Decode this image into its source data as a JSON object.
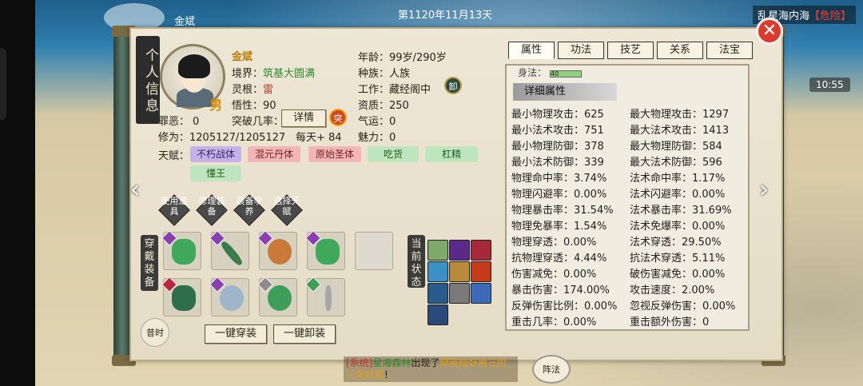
{
  "topbar": {
    "player_name": "金斌",
    "date": "第1120年11月13天",
    "region": "乱星海内海",
    "danger": "【危险】",
    "time": "10:55"
  },
  "panel": {
    "title": "个人信息"
  },
  "char": {
    "name": "金斌",
    "gender": "男",
    "realm_label": "境界：",
    "realm": "筑基大圆满",
    "root_label": "灵根：",
    "root": "雷",
    "comp_label": "悟性：",
    "comp": "90",
    "evil_label": "罪恶：",
    "evil": "0",
    "break_label": "突破几率：",
    "cult_label": "修为：",
    "cult": "1205127/1205127",
    "daily": "每天+ 84",
    "age_label": "年龄：",
    "age": "99岁/290岁",
    "race_label": "种族：",
    "race": "人族",
    "job_label": "工作：",
    "job": "藏经阁中",
    "apt_label": "资质：",
    "apt": "250",
    "qi_label": "气运：",
    "qi": "0",
    "charm_label": "魅力：",
    "charm": "0",
    "talent_label": "天赋：",
    "detail_btn": "详情",
    "tupo_icon": "突",
    "xie_icon": "卸"
  },
  "talents": [
    {
      "label": "不朽战体",
      "color": "purple"
    },
    {
      "label": "混元丹体",
      "color": "pink"
    },
    {
      "label": "原始圣体",
      "color": "pink"
    },
    {
      "label": "吃货",
      "color": "green"
    },
    {
      "label": "杠精",
      "color": "green"
    },
    {
      "label": "懂王",
      "color": "green"
    }
  ],
  "actions": [
    "使用道具",
    "修理装备",
    "装备孕养",
    "选择天赋"
  ],
  "equip_label": "穿戴装备",
  "state_label": "当前状态",
  "equip_btn": "一键穿装",
  "unequip_btn": "一键卸装",
  "bottom_left": "昔时",
  "tabs": [
    "属性",
    "功法",
    "技艺",
    "关系",
    "法宝"
  ],
  "attrs": {
    "top": "身法：",
    "top_value": "40",
    "header": "详细属性",
    "rows": [
      [
        "最小物理攻击：625",
        "最大物理攻击：1297"
      ],
      [
        "最小法术攻击：751",
        "最大法术攻击：1413"
      ],
      [
        "最小物理防御：378",
        "最大物理防御：584"
      ],
      [
        "最小法术防御：339",
        "最大法术防御：596"
      ],
      [
        "物理命中率：3.74%",
        "法术命中率：1.17%"
      ],
      [
        "物理闪避率：0.00%",
        "法术闪避率：0.00%"
      ],
      [
        "物理暴击率：31.54%",
        "法术暴击率：31.69%"
      ],
      [
        "物理免暴率：1.54%",
        "法术免爆率：0.00%"
      ],
      [
        "物理穿透：0.00%",
        "法术穿透：29.50%"
      ],
      [
        "抗物理穿透：4.44%",
        "抗法术穿透：5.11%"
      ],
      [
        "伤害减免：0.00%",
        "破伤害减免：0.00%"
      ],
      [
        "暴击伤害：174.00%",
        "攻击速度：2.00%"
      ],
      [
        "反弹伤害比例：0.00%",
        "忽视反弹伤害：0.00%"
      ],
      [
        "重击几率：0.00%",
        "重击额外伤害：0"
      ]
    ]
  },
  "bottom_msg": {
    "sys": "[系统]",
    "place": "星海森林",
    "mid": "出现了",
    "mob": "精英级妖兽三阶三尾妖狐",
    "end": "!"
  },
  "bottom_icon": "阵法"
}
